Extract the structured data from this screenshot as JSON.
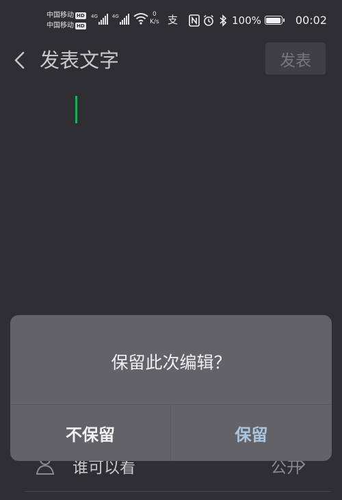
{
  "status_bar": {
    "carrier_1": "中国移动",
    "carrier_2": "中国移动",
    "hd_badge": "HD",
    "network_1": "4G",
    "network_2": "4G",
    "speed_value": "0",
    "speed_unit": "K/s",
    "battery_percent": "100%",
    "time": "00:02"
  },
  "header": {
    "title": "发表文字",
    "publish_label": "发表"
  },
  "settings": {
    "visibility_label": "谁可以看",
    "visibility_value": "公开"
  },
  "dialog": {
    "message": "保留此次编辑？",
    "discard_label": "不保留",
    "keep_label": "保留"
  },
  "colors": {
    "background": "#2e2e33",
    "dialog_background": "#626268",
    "cursor": "#1aad5b",
    "keep_button_text": "#a9c6e1"
  }
}
